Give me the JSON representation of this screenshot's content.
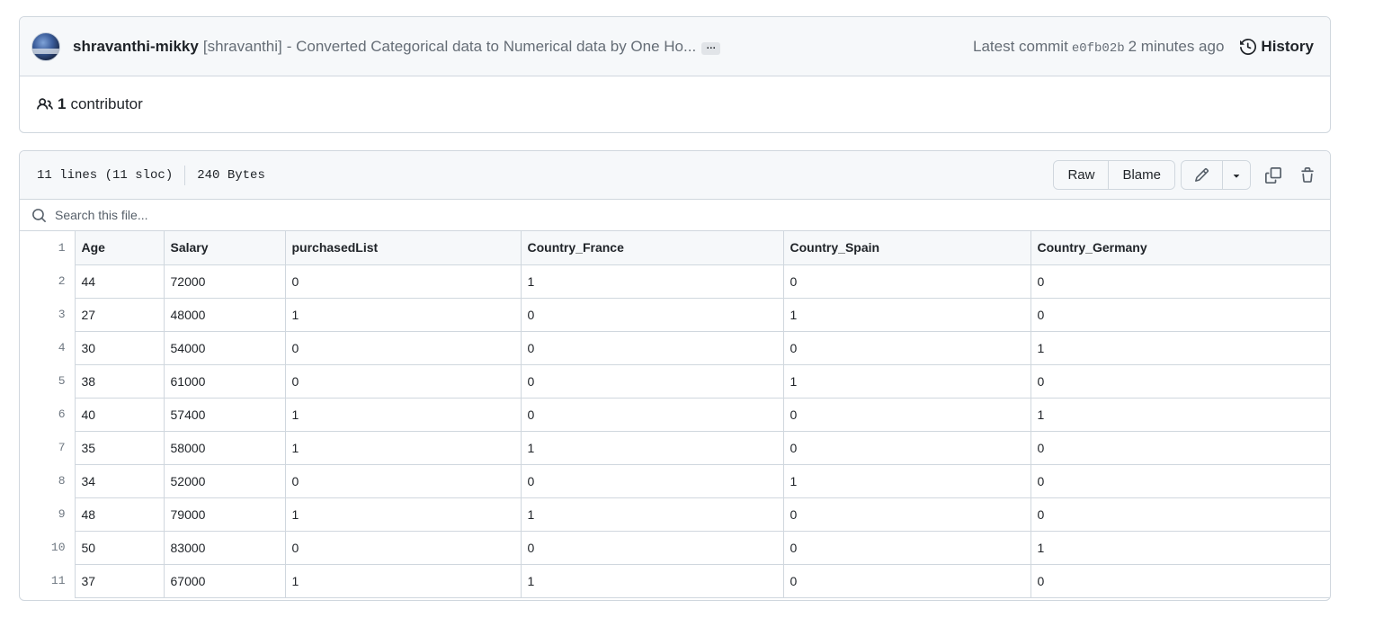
{
  "commit": {
    "author": "shravanthi-mikky",
    "alias": "[shravanthi]",
    "message": "- Converted Categorical data to Numerical data by One Ho...",
    "more": "…",
    "latest_label": "Latest commit",
    "sha": "e0fb02b",
    "time": "2 minutes ago",
    "history_label": "History"
  },
  "contributors": {
    "count": "1",
    "label": "contributor"
  },
  "file": {
    "lines": "11 lines (11 sloc)",
    "size": "240 Bytes",
    "raw_label": "Raw",
    "blame_label": "Blame"
  },
  "search": {
    "placeholder": "Search this file..."
  },
  "table": {
    "line_numbers": [
      "1",
      "2",
      "3",
      "4",
      "5",
      "6",
      "7",
      "8",
      "9",
      "10",
      "11"
    ],
    "rows": [
      [
        "Age",
        "Salary",
        "purchasedList",
        "Country_France",
        "Country_Spain",
        "Country_Germany"
      ],
      [
        "44",
        "72000",
        "0",
        "1",
        "0",
        "0"
      ],
      [
        "27",
        "48000",
        "1",
        "0",
        "1",
        "0"
      ],
      [
        "30",
        "54000",
        "0",
        "0",
        "0",
        "1"
      ],
      [
        "38",
        "61000",
        "0",
        "0",
        "1",
        "0"
      ],
      [
        "40",
        "57400",
        "1",
        "0",
        "0",
        "1"
      ],
      [
        "35",
        "58000",
        "1",
        "1",
        "0",
        "0"
      ],
      [
        "34",
        "52000",
        "0",
        "0",
        "1",
        "0"
      ],
      [
        "48",
        "79000",
        "1",
        "1",
        "0",
        "0"
      ],
      [
        "50",
        "83000",
        "0",
        "0",
        "0",
        "1"
      ],
      [
        "37",
        "67000",
        "1",
        "1",
        "0",
        "0"
      ]
    ]
  },
  "icons": {
    "history": "history-icon",
    "people": "people-icon",
    "pencil": "pencil-icon",
    "caret": "triangle-down-icon",
    "copy": "copy-icon",
    "trash": "trash-icon",
    "search": "search-icon"
  }
}
